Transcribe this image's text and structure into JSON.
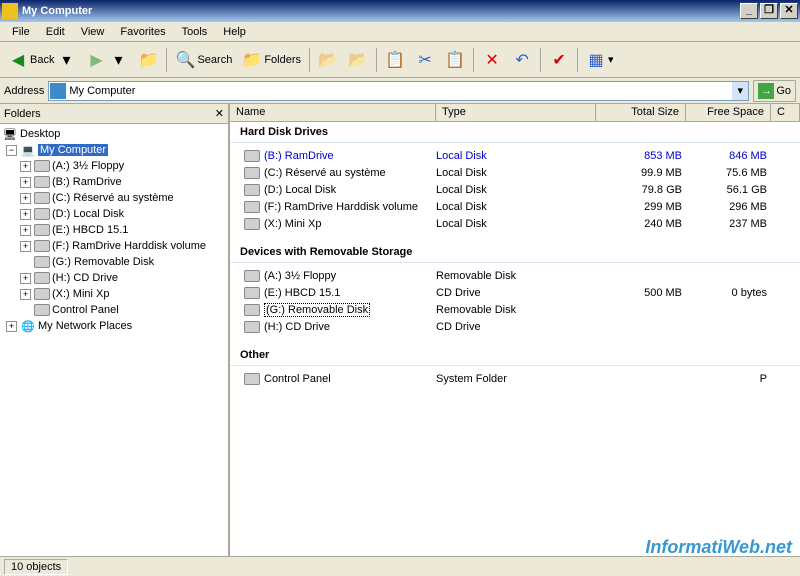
{
  "title": "My Computer",
  "menus": [
    "File",
    "Edit",
    "View",
    "Favorites",
    "Tools",
    "Help"
  ],
  "toolbar": {
    "back": "Back",
    "search": "Search",
    "folders": "Folders"
  },
  "address": {
    "label": "Address",
    "value": "My Computer",
    "go": "Go"
  },
  "folders_pane": {
    "title": "Folders"
  },
  "tree": {
    "desktop": "Desktop",
    "mycomputer": "My Computer",
    "items": [
      "(A:) 3½ Floppy",
      "(B:) RamDrive",
      "(C:) Réservé au système",
      "(D:) Local Disk",
      "(E:) HBCD 15.1",
      "(F:) RamDrive Harddisk volume",
      "(G:) Removable Disk",
      "(H:) CD Drive",
      "(X:) Mini Xp",
      "Control Panel"
    ],
    "network": "My Network Places"
  },
  "cols": {
    "name": "Name",
    "type": "Type",
    "total": "Total Size",
    "free": "Free Space"
  },
  "groups": {
    "hdd": "Hard Disk Drives",
    "removable": "Devices with Removable Storage",
    "other": "Other"
  },
  "hdd": [
    {
      "n": "(B:) RamDrive",
      "t": "Local Disk",
      "s": "853 MB",
      "f": "846 MB",
      "hl": true
    },
    {
      "n": "(C:) Réservé au système",
      "t": "Local Disk",
      "s": "99.9 MB",
      "f": "75.6 MB"
    },
    {
      "n": "(D:) Local Disk",
      "t": "Local Disk",
      "s": "79.8 GB",
      "f": "56.1 GB"
    },
    {
      "n": "(F:) RamDrive Harddisk volume",
      "t": "Local Disk",
      "s": "299 MB",
      "f": "296 MB"
    },
    {
      "n": "(X:) Mini Xp",
      "t": "Local Disk",
      "s": "240 MB",
      "f": "237 MB"
    }
  ],
  "rem": [
    {
      "n": "(A:) 3½ Floppy",
      "t": "Removable Disk",
      "s": "",
      "f": ""
    },
    {
      "n": "(E:) HBCD 15.1",
      "t": "CD Drive",
      "s": "500 MB",
      "f": "0 bytes"
    },
    {
      "n": "(G:) Removable Disk",
      "t": "Removable Disk",
      "s": "",
      "f": "",
      "sel": true
    },
    {
      "n": "(H:) CD Drive",
      "t": "CD Drive",
      "s": "",
      "f": ""
    }
  ],
  "oth": [
    {
      "n": "Control Panel",
      "t": "System Folder",
      "s": "",
      "f": "P"
    }
  ],
  "status": "10 objects",
  "watermark": "InformatiWeb.net"
}
